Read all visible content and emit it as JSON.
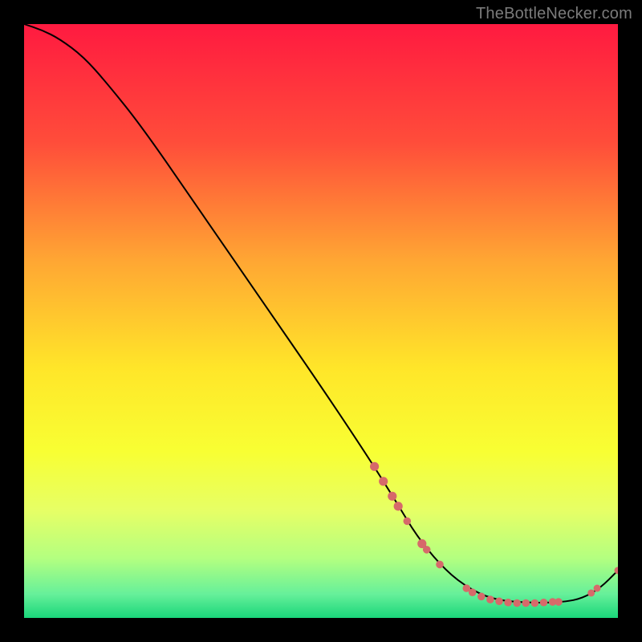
{
  "watermark": "TheBottleNecker.com",
  "chart_data": {
    "type": "line",
    "title": "",
    "xlabel": "",
    "ylabel": "",
    "xlim": [
      0,
      100
    ],
    "ylim": [
      0,
      100
    ],
    "grid": false,
    "legend": false,
    "background_gradient_stops": [
      {
        "offset": 0.0,
        "color": "#ff1a40"
      },
      {
        "offset": 0.2,
        "color": "#ff4d3a"
      },
      {
        "offset": 0.4,
        "color": "#ffa733"
      },
      {
        "offset": 0.58,
        "color": "#ffe629"
      },
      {
        "offset": 0.72,
        "color": "#f8ff33"
      },
      {
        "offset": 0.82,
        "color": "#e6ff66"
      },
      {
        "offset": 0.9,
        "color": "#b3ff80"
      },
      {
        "offset": 0.96,
        "color": "#66f09a"
      },
      {
        "offset": 1.0,
        "color": "#1ad67a"
      }
    ],
    "series": [
      {
        "name": "curve",
        "color": "#000000",
        "x": [
          0,
          3,
          6,
          10,
          14,
          20,
          30,
          40,
          50,
          58,
          63,
          66,
          70,
          74,
          79,
          86,
          91,
          94,
          97,
          100
        ],
        "y": [
          100,
          99,
          97.5,
          94.5,
          90,
          82.5,
          68,
          53.5,
          39,
          27,
          19,
          14,
          9,
          5.5,
          3,
          2.5,
          2.7,
          3.3,
          5,
          8
        ]
      }
    ],
    "marker_clusters": [
      {
        "color": "#d66a6a",
        "points": [
          {
            "x": 59,
            "y": 25.5,
            "r": 3.5
          },
          {
            "x": 60.5,
            "y": 23,
            "r": 3.5
          },
          {
            "x": 62,
            "y": 20.5,
            "r": 3.5
          },
          {
            "x": 63,
            "y": 18.8,
            "r": 3.5
          },
          {
            "x": 64.5,
            "y": 16.3,
            "r": 3.0
          },
          {
            "x": 67,
            "y": 12.5,
            "r": 3.5
          },
          {
            "x": 67.8,
            "y": 11.5,
            "r": 3.0
          },
          {
            "x": 70,
            "y": 9,
            "r": 3.0
          },
          {
            "x": 74.5,
            "y": 5,
            "r": 3.0
          },
          {
            "x": 75.5,
            "y": 4.3,
            "r": 3.0
          },
          {
            "x": 77,
            "y": 3.6,
            "r": 3.0
          },
          {
            "x": 78.5,
            "y": 3.1,
            "r": 3.0
          },
          {
            "x": 80,
            "y": 2.8,
            "r": 3.0
          },
          {
            "x": 81.5,
            "y": 2.6,
            "r": 3.0
          },
          {
            "x": 83,
            "y": 2.5,
            "r": 3.0
          },
          {
            "x": 84.5,
            "y": 2.5,
            "r": 3.0
          },
          {
            "x": 86,
            "y": 2.5,
            "r": 3.0
          },
          {
            "x": 87.5,
            "y": 2.6,
            "r": 3.0
          },
          {
            "x": 89,
            "y": 2.7,
            "r": 3.0
          },
          {
            "x": 90,
            "y": 2.7,
            "r": 3.0
          },
          {
            "x": 95.5,
            "y": 4.2,
            "r": 2.8
          },
          {
            "x": 96.5,
            "y": 5.0,
            "r": 2.8
          },
          {
            "x": 100,
            "y": 8.0,
            "r": 2.8
          }
        ]
      }
    ]
  }
}
